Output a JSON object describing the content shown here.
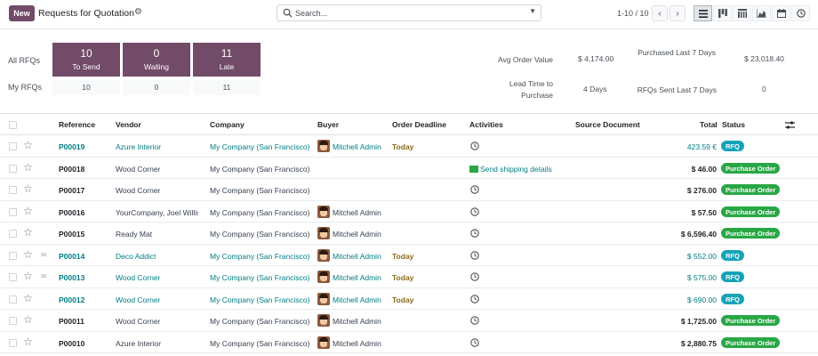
{
  "control_panel": {
    "new_label": "New",
    "title": "Requests for Quotation",
    "search_placeholder": "Search...",
    "pager": "1-10 / 10"
  },
  "dashboard": {
    "all_rfqs_label": "All RFQs",
    "my_rfqs_label": "My RFQs",
    "tiles": [
      {
        "value": "10",
        "label": "To Send",
        "mine": "10"
      },
      {
        "value": "0",
        "label": "Waiting",
        "mine": "0"
      },
      {
        "value": "11",
        "label": "Late",
        "mine": "11"
      }
    ],
    "kpis": {
      "avg_order_value_label": "Avg Order Value",
      "avg_order_value": "$ 4,174.00",
      "purchased_last_7_label": "Purchased Last 7 Days",
      "purchased_last_7": "$ 23,018.40",
      "lead_time_label": "Lead Time to Purchase",
      "lead_time": "4 Days",
      "rfqs_sent_label": "RFQs Sent Last 7 Days",
      "rfqs_sent": "0"
    }
  },
  "table": {
    "headers": {
      "reference": "Reference",
      "vendor": "Vendor",
      "company": "Company",
      "buyer": "Buyer",
      "deadline": "Order Deadline",
      "activities": "Activities",
      "source": "Source Document",
      "total": "Total",
      "status": "Status"
    },
    "rows": [
      {
        "ref": "P00019",
        "vendor": "Azure Interior",
        "company": "My Company (San Francisco)",
        "buyer": "Mitchell Admin",
        "deadline": "Today",
        "activity": "clock",
        "total": "423.59 €",
        "status": "RFQ"
      },
      {
        "ref": "P00018",
        "vendor": "Wood Corner",
        "company": "My Company (San Francisco)",
        "buyer": "",
        "deadline": "",
        "activity": "Send shipping details",
        "total": "$ 46.00",
        "status": "Purchase Order"
      },
      {
        "ref": "P00017",
        "vendor": "Wood Corner",
        "company": "My Company (San Francisco)",
        "buyer": "",
        "deadline": "",
        "activity": "clock",
        "total": "$ 276.00",
        "status": "Purchase Order"
      },
      {
        "ref": "P00016",
        "vendor": "YourCompany, Joel Willis",
        "company": "My Company (San Francisco)",
        "buyer": "Mitchell Admin",
        "deadline": "",
        "activity": "clock",
        "total": "$ 57.50",
        "status": "Purchase Order"
      },
      {
        "ref": "P00015",
        "vendor": "Ready Mat",
        "company": "My Company (San Francisco)",
        "buyer": "Mitchell Admin",
        "deadline": "",
        "activity": "clock",
        "total": "$ 6,596.40",
        "status": "Purchase Order"
      },
      {
        "ref": "P00014",
        "vendor": "Deco Addict",
        "company": "My Company (San Francisco)",
        "buyer": "Mitchell Admin",
        "deadline": "Today",
        "activity": "clock",
        "total": "$ 552.00",
        "status": "RFQ"
      },
      {
        "ref": "P00013",
        "vendor": "Wood Corner",
        "company": "My Company (San Francisco)",
        "buyer": "Mitchell Admin",
        "deadline": "Today",
        "activity": "clock",
        "total": "$ 575.00",
        "status": "RFQ"
      },
      {
        "ref": "P00012",
        "vendor": "Wood Corner",
        "company": "My Company (San Francisco)",
        "buyer": "Mitchell Admin",
        "deadline": "Today",
        "activity": "clock",
        "total": "$ 690.00",
        "status": "RFQ"
      },
      {
        "ref": "P00011",
        "vendor": "Wood Corner",
        "company": "My Company (San Francisco)",
        "buyer": "Mitchell Admin",
        "deadline": "",
        "activity": "clock",
        "total": "$ 1,725.00",
        "status": "Purchase Order"
      },
      {
        "ref": "P00010",
        "vendor": "Azure Interior",
        "company": "My Company (San Francisco)",
        "buyer": "Mitchell Admin",
        "deadline": "",
        "activity": "clock",
        "total": "$ 2,880.75",
        "status": "Purchase Order"
      }
    ]
  },
  "colors": {
    "brand": "#714b67",
    "link": "#017e84",
    "rfq": "#17a2b8",
    "purchase_order": "#28a745",
    "today": "#8a6d1b"
  }
}
